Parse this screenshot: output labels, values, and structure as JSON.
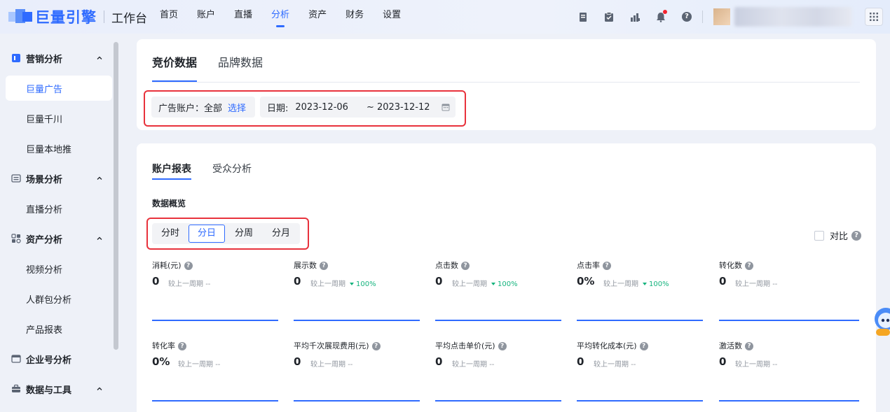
{
  "brand": {
    "name": "巨量引擎",
    "sub": "工作台",
    "accent": "#2f6bff",
    "highlight": "#e8323c",
    "positive": "#14b37d"
  },
  "topnav": [
    {
      "label": "首页",
      "active": false
    },
    {
      "label": "账户",
      "active": false
    },
    {
      "label": "直播",
      "active": false
    },
    {
      "label": "分析",
      "active": true
    },
    {
      "label": "资产",
      "active": false
    },
    {
      "label": "财务",
      "active": false
    },
    {
      "label": "设置",
      "active": false
    }
  ],
  "top_icons": [
    "document-icon",
    "clipboard-icon",
    "chart-hand-icon",
    "bell-icon",
    "help-icon"
  ],
  "sidebar": {
    "groups": [
      {
        "label": "营销分析",
        "icon": "marketing-icon",
        "expanded": true
      },
      {
        "label": "场景分析",
        "icon": "scene-icon",
        "expanded": true
      },
      {
        "label": "资产分析",
        "icon": "asset-icon",
        "expanded": true
      },
      {
        "label": "企业号分析",
        "icon": "enterprise-icon",
        "expanded": false
      },
      {
        "label": "数据与工具",
        "icon": "tools-icon",
        "expanded": true
      }
    ],
    "items": [
      {
        "label": "巨量广告",
        "active": true
      },
      {
        "label": "巨量千川",
        "active": false
      },
      {
        "label": "巨量本地推",
        "active": false
      },
      {
        "label": "直播分析",
        "active": false
      },
      {
        "label": "视频分析",
        "active": false
      },
      {
        "label": "人群包分析",
        "active": false
      },
      {
        "label": "产品报表",
        "active": false
      }
    ]
  },
  "main_tabs": [
    {
      "label": "竞价数据",
      "active": true
    },
    {
      "label": "品牌数据",
      "active": false
    }
  ],
  "filters": {
    "account_label": "广告账户：",
    "account_value": "全部",
    "account_link": "选择",
    "date_label": "日期:",
    "date_start": "2023-12-06",
    "date_end": "~ 2023-12-12"
  },
  "sub_tabs": [
    {
      "label": "账户报表",
      "active": true
    },
    {
      "label": "受众分析",
      "active": false
    }
  ],
  "overview_title": "数据概览",
  "granularity": [
    {
      "label": "分时",
      "active": false
    },
    {
      "label": "分日",
      "active": true
    },
    {
      "label": "分周",
      "active": false
    },
    {
      "label": "分月",
      "active": false
    }
  ],
  "compare_label": "对比",
  "metrics": [
    {
      "label": "消耗(元)",
      "value": "0",
      "cmp_label": "较上一周期",
      "cmp_value": "--",
      "delta": null
    },
    {
      "label": "展示数",
      "value": "0",
      "cmp_label": "较上一周期",
      "cmp_value": "",
      "delta": "100%"
    },
    {
      "label": "点击数",
      "value": "0",
      "cmp_label": "较上一周期",
      "cmp_value": "",
      "delta": "100%"
    },
    {
      "label": "点击率",
      "value": "0%",
      "cmp_label": "较上一周期",
      "cmp_value": "",
      "delta": "100%"
    },
    {
      "label": "转化数",
      "value": "0",
      "cmp_label": "较上一周期",
      "cmp_value": "--",
      "delta": null
    },
    {
      "label": "转化率",
      "value": "0%",
      "cmp_label": "较上一周期",
      "cmp_value": "--",
      "delta": null
    },
    {
      "label": "平均千次展现费用(元)",
      "value": "0",
      "cmp_label": "较上一周期",
      "cmp_value": "--",
      "delta": null
    },
    {
      "label": "平均点击单价(元)",
      "value": "0",
      "cmp_label": "较上一周期",
      "cmp_value": "--",
      "delta": null
    },
    {
      "label": "平均转化成本(元)",
      "value": "0",
      "cmp_label": "较上一周期",
      "cmp_value": "--",
      "delta": null
    },
    {
      "label": "激活数",
      "value": "0",
      "cmp_label": "较上一周期",
      "cmp_value": "--",
      "delta": null
    }
  ]
}
